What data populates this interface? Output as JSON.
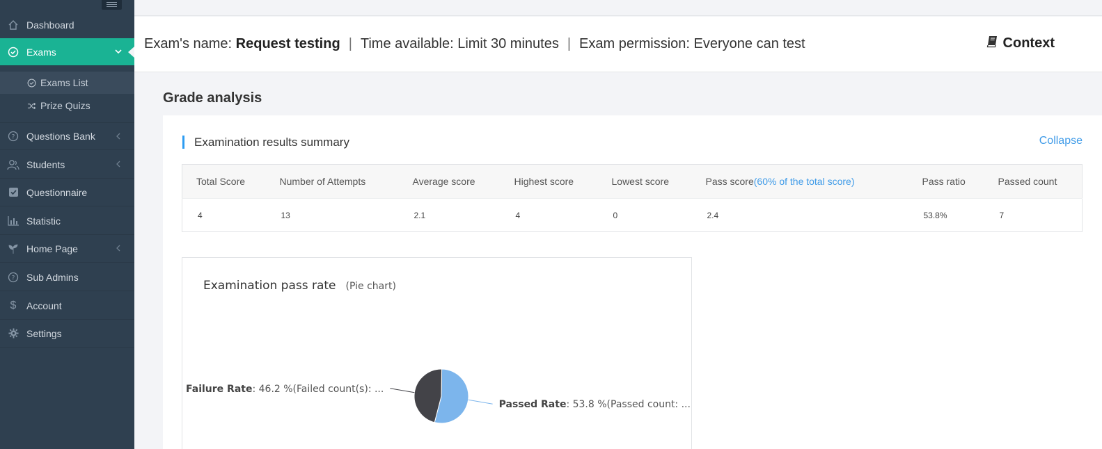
{
  "sidebar": {
    "items": [
      {
        "label": "Dashboard",
        "icon": "home-icon"
      },
      {
        "label": "Exams",
        "icon": "check-circle-icon"
      },
      {
        "label": "Questions Bank",
        "icon": "question-circle-icon"
      },
      {
        "label": "Students",
        "icon": "users-icon"
      },
      {
        "label": "Questionnaire",
        "icon": "checkbox-icon"
      },
      {
        "label": "Statistic",
        "icon": "bar-chart-icon"
      },
      {
        "label": "Home Page",
        "icon": "leaf-icon"
      },
      {
        "label": "Sub Admins",
        "icon": "question-circle-icon"
      },
      {
        "label": "Account",
        "icon": "dollar-icon"
      },
      {
        "label": "Settings",
        "icon": "gear-icon"
      }
    ],
    "subitems": [
      {
        "label": "Exams List",
        "icon": "check-circle-icon"
      },
      {
        "label": "Prize Quizs",
        "icon": "shuffle-icon"
      }
    ]
  },
  "exam": {
    "name_label": "Exam's name:",
    "name_value": "Request testing",
    "sep": "|",
    "time_label": "Time available: Limit 30 minutes",
    "permission_label": "Exam permission: Everyone can test",
    "context_label": "Context"
  },
  "grade_title": "Grade analysis",
  "summary": {
    "title": "Examination results summary",
    "collapse": "Collapse",
    "headers": [
      "Total Score",
      "Number of Attempts",
      "Average score",
      "Highest score",
      "Lowest score",
      "Pass score",
      "Pass ratio",
      "Passed count"
    ],
    "pass_score_hint": "(60% of the total score)",
    "values": [
      "4",
      "13",
      "2.1",
      "4",
      "0",
      "2.4",
      "53.8%",
      "7"
    ]
  },
  "chart_data": {
    "type": "pie",
    "title": "Examination pass rate",
    "subtitle": "(Pie chart)",
    "slices": [
      {
        "name": "Passed Rate",
        "label_rest": ": 53.8 %(Passed count: ...",
        "value": 53.8,
        "color": "#7cb5ec"
      },
      {
        "name": "Failure Rate",
        "label_rest": ": 46.2 %(Failed count(s): ...",
        "value": 46.2,
        "color": "#434348"
      }
    ]
  },
  "colors": {
    "sidebar_bg": "#2f4050",
    "accent": "#1ab394",
    "link": "#3f9be8"
  }
}
